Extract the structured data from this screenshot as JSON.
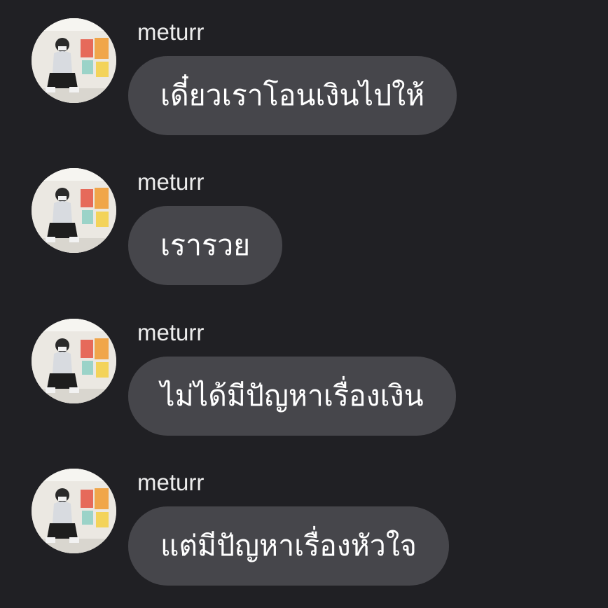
{
  "chat": {
    "messages": [
      {
        "username": "meturr",
        "text": "เดี๋ยวเราโอนเงินไปให้"
      },
      {
        "username": "meturr",
        "text": "เรารวย"
      },
      {
        "username": "meturr",
        "text": "ไม่ได้มีปัญหาเรื่องเงิน"
      },
      {
        "username": "meturr",
        "text": "แต่มีปัญหาเรื่องหัวใจ"
      }
    ]
  },
  "colors": {
    "background": "#202024",
    "bubble": "#46464b",
    "text": "#ffffff",
    "username": "#ececec"
  },
  "icons": {
    "avatar": "profile-photo-avatar"
  }
}
